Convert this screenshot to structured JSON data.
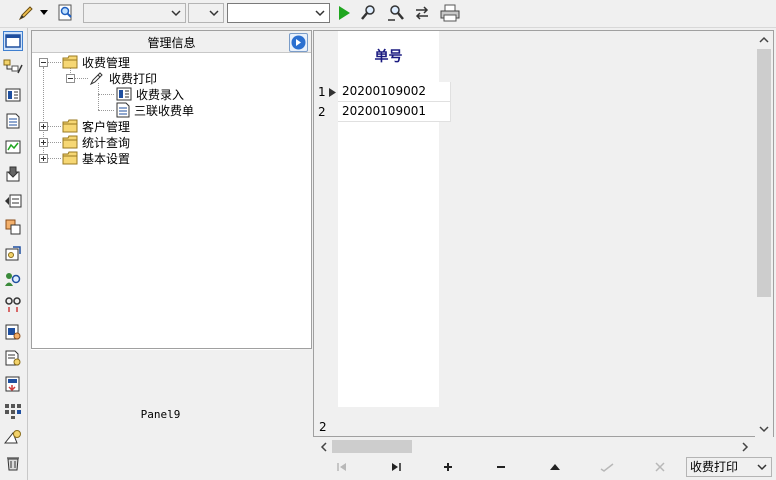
{
  "toolbar": {
    "icons": [
      "pencil-icon",
      "magnify-doc-icon",
      "run-icon",
      "find-icon",
      "find-next-icon",
      "refresh-icon",
      "print-icon"
    ],
    "combo1_value": "",
    "combo2_value": "",
    "combo3_value": ""
  },
  "sidebar_icons": [
    "window-icon",
    "tree-icon",
    "card-icon",
    "doc-icon",
    "chart-icon",
    "inbox-icon",
    "export-icon",
    "copy-icon",
    "settings-icon",
    "search-user-icon",
    "link-icon",
    "form-icon",
    "report-icon",
    "import-icon",
    "grid-icon",
    "tools-icon",
    "trash-icon"
  ],
  "tree_panel": {
    "title": "管理信息",
    "nodes": [
      {
        "label": "收费管理",
        "icon": "folder-icon"
      },
      {
        "label": "收费打印",
        "icon": "pen-icon"
      },
      {
        "label": "收费录入",
        "icon": "form-icon"
      },
      {
        "label": "三联收费单",
        "icon": "doc-icon"
      },
      {
        "label": "客户管理",
        "icon": "folder-icon"
      },
      {
        "label": "统计查询",
        "icon": "folder-icon"
      },
      {
        "label": "基本设置",
        "icon": "folder-icon"
      }
    ]
  },
  "panel9": {
    "caption": "Panel9"
  },
  "grid": {
    "column_header": "单号",
    "rows": [
      {
        "indicator": "1",
        "value": "20200109002"
      },
      {
        "indicator": "2",
        "value": "20200109001"
      }
    ],
    "footer_count": "2"
  },
  "navigator": {
    "buttons": [
      {
        "name": "first",
        "label": "|◀"
      },
      {
        "name": "last",
        "label": "▶|"
      },
      {
        "name": "insert",
        "label": "+"
      },
      {
        "name": "delete",
        "label": "−"
      },
      {
        "name": "edit",
        "label": "▲"
      },
      {
        "name": "post",
        "label": "✓"
      },
      {
        "name": "cancel",
        "label": "✕"
      }
    ],
    "combo_value": "收费打印"
  }
}
